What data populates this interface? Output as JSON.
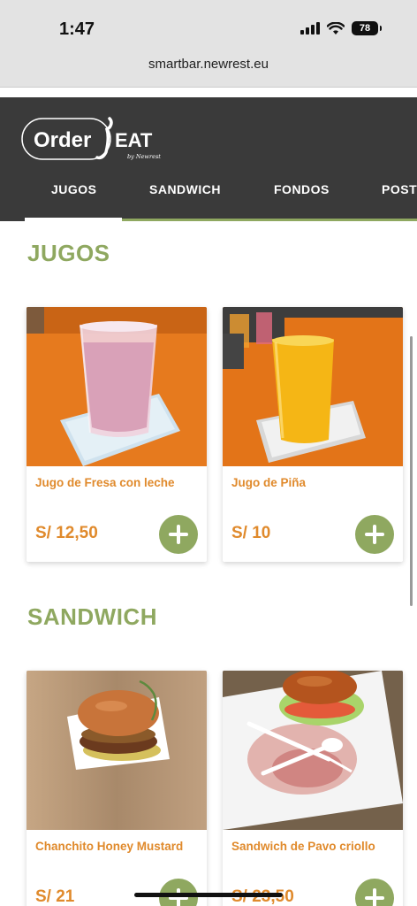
{
  "status_bar": {
    "time": "1:47",
    "battery": "78"
  },
  "browser": {
    "url": "smartbar.newrest.eu"
  },
  "logo": {
    "text_order": "Order",
    "text_eat": "EAT",
    "text_by": "by Newrest"
  },
  "tabs": [
    {
      "label": "JUGOS"
    },
    {
      "label": "SANDWICH"
    },
    {
      "label": "FONDOS"
    },
    {
      "label": "POST"
    }
  ],
  "sections": [
    {
      "title": "JUGOS",
      "items": [
        {
          "name": "Jugo de Fresa con leche",
          "price": "S/ 12,50",
          "image": "strawberry-milk-juice"
        },
        {
          "name": "Jugo de Piña",
          "price": "S/ 10",
          "image": "pineapple-juice"
        }
      ]
    },
    {
      "title": "SANDWICH",
      "items": [
        {
          "name": "Chanchito Honey Mustard",
          "price": "S/ 21",
          "image": "pork-burger"
        },
        {
          "name": "Sandwich de Pavo criollo",
          "price": "S/ 23,50",
          "image": "turkey-sandwich"
        }
      ]
    }
  ],
  "colors": {
    "accent": "#8fa860",
    "price": "#e08a2c",
    "header": "#3a3a3a"
  }
}
